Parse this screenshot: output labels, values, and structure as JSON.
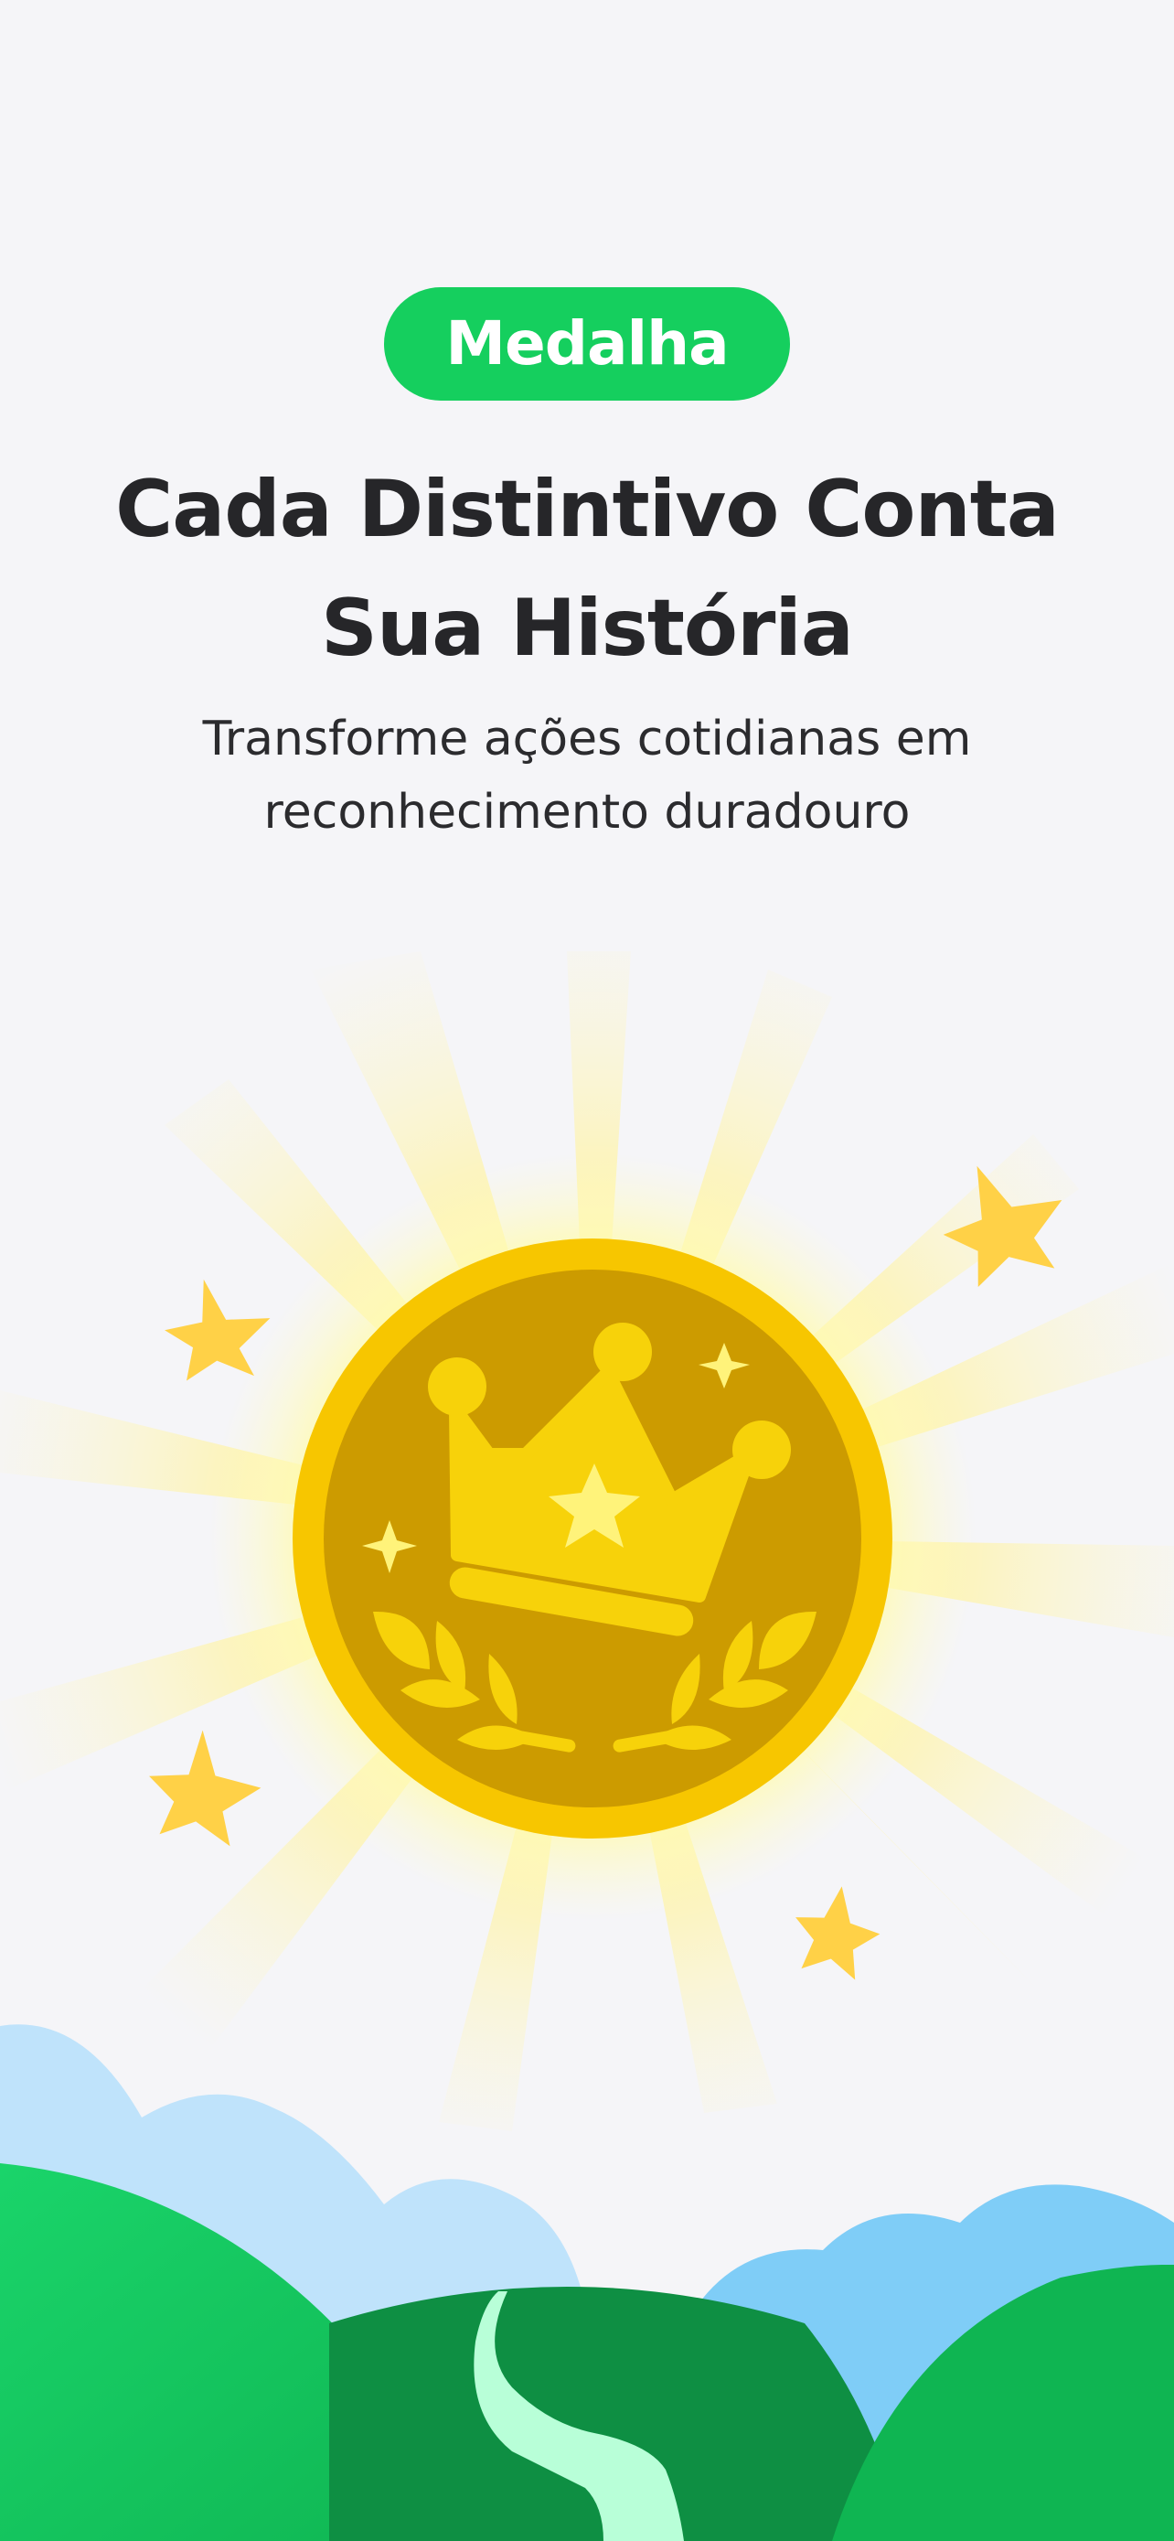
{
  "header": {
    "badge_label": "Medalha",
    "title_line1": "Cada Distintivo Conta",
    "title_line2": "Sua História",
    "subtitle_line1": "Transforme ações cotidianas em",
    "subtitle_line2": "reconhecimento duradouro"
  },
  "illustration": {
    "medal_icon": "crown-medal-icon",
    "sparkle_icon": "star-sparkle-icon",
    "landscape": "hills-and-path"
  },
  "colors": {
    "accent_green": "#15cf5e",
    "gold": "#f7c600",
    "gold_dark": "#cc9b00",
    "crown": "#f7d20a",
    "star": "#ffd147",
    "background": "#f5f5f8"
  }
}
